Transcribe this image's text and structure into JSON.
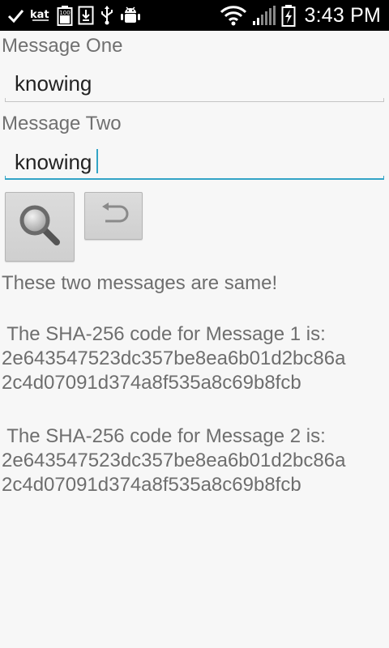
{
  "status_bar": {
    "time": "3:43 PM",
    "left_icons": [
      "check-icon",
      "app-logo-icon",
      "battery-100-icon",
      "download-icon",
      "usb-icon",
      "android-debug-icon"
    ],
    "right_icons": [
      "wifi-icon",
      "cell-signal-icon",
      "battery-charging-icon"
    ],
    "battery_level_label": "100"
  },
  "form": {
    "message_one_label": "Message One",
    "message_one_value": "knowing",
    "message_two_label": "Message Two",
    "message_two_value": "knowing"
  },
  "buttons": {
    "search_icon": "magnifier-icon",
    "reset_icon": "undo-icon"
  },
  "result": {
    "comparison_text": "These two messages are same!",
    "hash1_heading": " The SHA-256 code for Message 1 is:",
    "hash1_line1": "2e643547523dc357be8ea6b01d2bc86a",
    "hash1_line2": "2c4d07091d374a8f535a8c69b8fcb",
    "hash2_heading": " The SHA-256 code for Message 2 is:",
    "hash2_line1": "2e643547523dc357be8ea6b01d2bc86a",
    "hash2_line2": "2c4d07091d374a8f535a8c69b8fcb"
  },
  "colors": {
    "accent": "#33a4c6",
    "background": "#f7f7f7",
    "status_bar": "#000000",
    "text_secondary": "#6e6e6e"
  }
}
